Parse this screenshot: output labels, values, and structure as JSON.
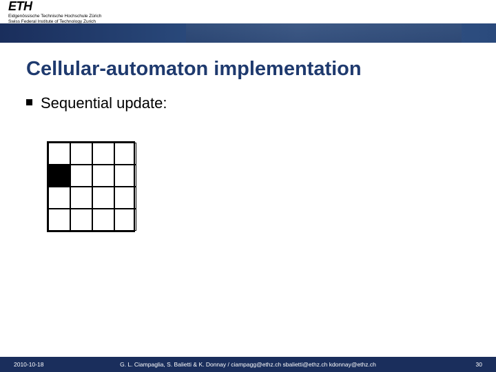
{
  "header": {
    "logo_main": "ETH",
    "logo_sub1": "Eidgenössische Technische Hochschule Zürich",
    "logo_sub2": "Swiss Federal Institute of Technology Zurich"
  },
  "slide": {
    "title": "Cellular-automaton implementation",
    "bullet1": "Sequential update:"
  },
  "grid": {
    "rows": 4,
    "cols": 4,
    "filled_cells": [
      [
        1,
        0
      ]
    ]
  },
  "footer": {
    "date": "2010-10-18",
    "authors": "G. L. Ciampaglia, S. Balietti & K. Donnay /  ciampagg@ethz.ch  sbalietti@ethz.ch  kdonnay@ethz.ch",
    "page": "30"
  }
}
